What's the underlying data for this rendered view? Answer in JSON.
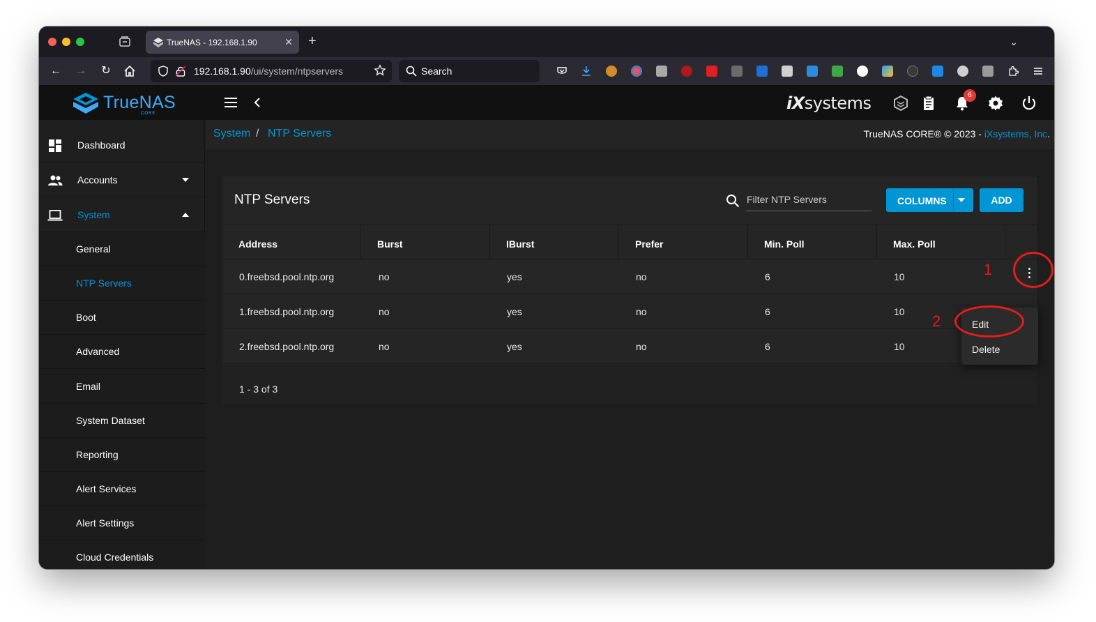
{
  "browser": {
    "tab_title": "TrueNAS - 192.168.1.90",
    "url_host": "192.168.1.90",
    "url_path": "/ui/system/ntpservers",
    "search_label": "Search"
  },
  "app": {
    "logo_text": "TrueNAS",
    "logo_sub": "CORE",
    "vendor_logo_prefix": "iX",
    "vendor_logo_suffix": "systems",
    "notifications_count": "6",
    "accent_color": "#0095d5"
  },
  "sidebar": {
    "items": [
      {
        "label": "Dashboard",
        "icon": "dashboard-icon"
      },
      {
        "label": "Accounts",
        "icon": "accounts-icon"
      },
      {
        "label": "System",
        "icon": "laptop-icon"
      }
    ],
    "system_children": [
      {
        "label": "General"
      },
      {
        "label": "NTP Servers"
      },
      {
        "label": "Boot"
      },
      {
        "label": "Advanced"
      },
      {
        "label": "Email"
      },
      {
        "label": "System Dataset"
      },
      {
        "label": "Reporting"
      },
      {
        "label": "Alert Services"
      },
      {
        "label": "Alert Settings"
      },
      {
        "label": "Cloud Credentials"
      }
    ]
  },
  "breadcrumb": {
    "parent": "System",
    "separator": "/",
    "current": "NTP Servers"
  },
  "footer_copyright": {
    "text": "TrueNAS CORE® © 2023 - ",
    "link": "iXsystems, Inc",
    "end": "."
  },
  "card": {
    "title": "NTP Servers",
    "filter_placeholder": "Filter NTP Servers",
    "columns_button": "COLUMNS",
    "add_button": "ADD",
    "columns": [
      "Address",
      "Burst",
      "IBurst",
      "Prefer",
      "Min. Poll",
      "Max. Poll"
    ],
    "rows": [
      [
        "0.freebsd.pool.ntp.org",
        "no",
        "yes",
        "no",
        "6",
        "10"
      ],
      [
        "1.freebsd.pool.ntp.org",
        "no",
        "yes",
        "no",
        "6",
        "10"
      ],
      [
        "2.freebsd.pool.ntp.org",
        "no",
        "yes",
        "no",
        "6",
        "10"
      ]
    ],
    "pagination": "1 - 3 of 3"
  },
  "row_menu": {
    "items": [
      "Edit",
      "Delete"
    ]
  },
  "annotations": {
    "step1": "1",
    "step2": "2",
    "color": "#e81b1b"
  }
}
